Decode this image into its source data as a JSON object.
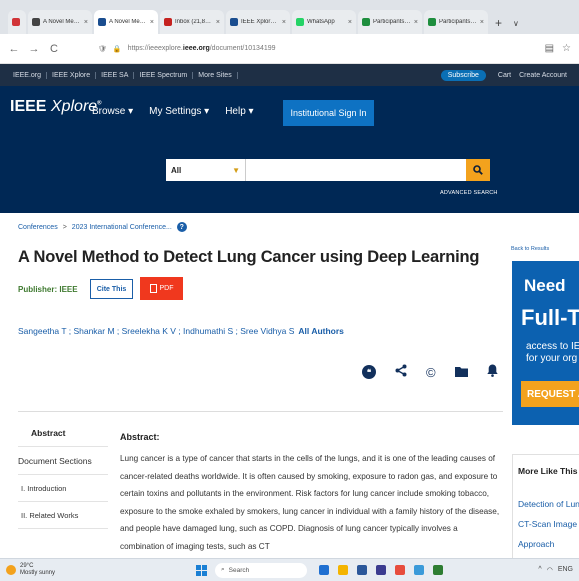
{
  "browser": {
    "tabs": [
      {
        "label": "",
        "color": "#d13438",
        "pinned": true
      },
      {
        "label": "A Novel Method to D",
        "color": "#444444"
      },
      {
        "label": "A Novel Method to D",
        "color": "#1a4d8f",
        "active": true
      },
      {
        "label": "Inbox (21,804) - tsan",
        "color": "#c5221f"
      },
      {
        "label": "IEEE Xplore - Contac",
        "color": "#1a4d8f"
      },
      {
        "label": "WhatsApp",
        "color": "#25d366"
      },
      {
        "label": "Participants of Netcr",
        "color": "#1e8e3e"
      },
      {
        "label": "Participants of Netcr",
        "color": "#1e8e3e"
      }
    ],
    "tab_close": "×",
    "new_tab": "+",
    "tab_menu": "∨",
    "url_prefix": "https://ieeexplore.",
    "url_domain": "ieee.org",
    "url_path": "/document/10134199",
    "back": "←",
    "forward": "→",
    "reload": "C"
  },
  "ieee_top": {
    "links": [
      "IEEE.org",
      "IEEE Xplore",
      "IEEE SA",
      "IEEE Spectrum",
      "More Sites"
    ],
    "subscribe": "Subscribe",
    "cart": "Cart",
    "create_account": "Create Account"
  },
  "header": {
    "logo_main": "IEEE",
    "logo_sub": "Xplore",
    "logo_reg": "®",
    "nav": [
      "Browse ▾",
      "My Settings ▾",
      "Help ▾"
    ],
    "institutional": "Institutional Sign In",
    "search_scope": "All",
    "search_placeholder": "",
    "advanced": "ADVANCED SEARCH"
  },
  "breadcrumb": {
    "items": [
      "Conferences",
      ">",
      "2023 International Conference..."
    ],
    "help": "?"
  },
  "article": {
    "title": "A Novel Method to Detect Lung Cancer using Deep Learning",
    "publisher": "Publisher: IEEE",
    "cite": "Cite This",
    "pdf": "PDF",
    "authors": "Sangeetha T ; Shankar M ; Sreelekha K V ; Indhumathi S ; Sree Vidhya S",
    "all_authors": "All Authors"
  },
  "left_nav": [
    "Abstract",
    "Document Sections",
    "I. Introduction",
    "II. Related Works"
  ],
  "abstract": {
    "heading": "Abstract:",
    "body": "Lung cancer is a type of cancer that starts in the cells of the lungs, and it is one of the leading causes of cancer-related deaths worldwide. It is often caused by smoking, exposure to radon gas, and exposure to certain toxins and pollutants in the environment. Risk factors for lung cancer include smoking tobacco, exposure to the smoke exhaled by smokers, lung cancer in individual with a family history of the disease, and people have damaged lung, such as COPD. Diagnosis of lung cancer typically involves a combination of imaging tests, such as CT"
  },
  "sidebar": {
    "back": "Back to Results",
    "ad_need": "Need",
    "ad_full": "Full-Te",
    "ad_access1": "access to IE",
    "ad_access2": "for your org",
    "ad_request": "REQUEST A F",
    "more_title": "More Like This",
    "more_links": [
      "Detection of Lung",
      "CT-Scan Image - D",
      "Approach"
    ]
  },
  "taskbar": {
    "temp": "29°C",
    "weather": "Mostly sunny",
    "search": "Search",
    "tray": [
      "^",
      "◠",
      "ENG"
    ]
  },
  "colors": {
    "ieee_navy": "#002855",
    "accent_orange": "#f3a21d",
    "pdf_red": "#f0381e",
    "link_blue": "#1a5ea8"
  }
}
